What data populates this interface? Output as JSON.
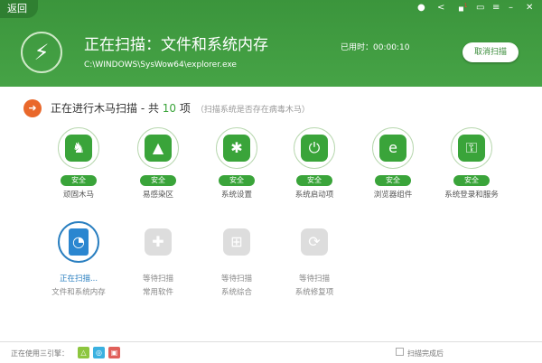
{
  "header": {
    "back": "返回",
    "title": "正在扫描：文件和系统内存",
    "path": "C:\\WINDOWS\\SysWow64\\explorer.exe",
    "elapsed": "已用时：00:00:10",
    "cancel": "取消扫描",
    "notif_count": "1"
  },
  "section": {
    "title": "正在进行木马扫描 - 共 ",
    "count": "10",
    "unit": " 项",
    "hint": "（扫描系统是否存在病毒木马）"
  },
  "done_items": [
    {
      "label": "顽固木马",
      "status": "安全",
      "icon": "horse-icon"
    },
    {
      "label": "易感染区",
      "status": "安全",
      "icon": "warning-triangle-icon"
    },
    {
      "label": "系统设置",
      "status": "安全",
      "icon": "windows-gear-icon"
    },
    {
      "label": "系统启动项",
      "status": "安全",
      "icon": "power-icon"
    },
    {
      "label": "浏览器组件",
      "status": "安全",
      "icon": "ie-icon"
    },
    {
      "label": "系统登录和服务",
      "status": "安全",
      "icon": "key-door-icon"
    }
  ],
  "pending_items": [
    {
      "status": "正在扫描...",
      "label": "文件和系统内存",
      "icon": "file-chart-icon"
    },
    {
      "status": "等待扫描",
      "label": "常用软件",
      "icon": "software-icon"
    },
    {
      "status": "等待扫描",
      "label": "系统综合",
      "icon": "windows-icon"
    },
    {
      "status": "等待扫描",
      "label": "系统修复项",
      "icon": "repair-icon"
    }
  ],
  "footer": {
    "engines": "正在使用三引擎：",
    "after_scan": "扫描完成后"
  },
  "colors": {
    "accent": "#3aa43a",
    "header": "#40993f",
    "scanning": "#2a86d0"
  }
}
